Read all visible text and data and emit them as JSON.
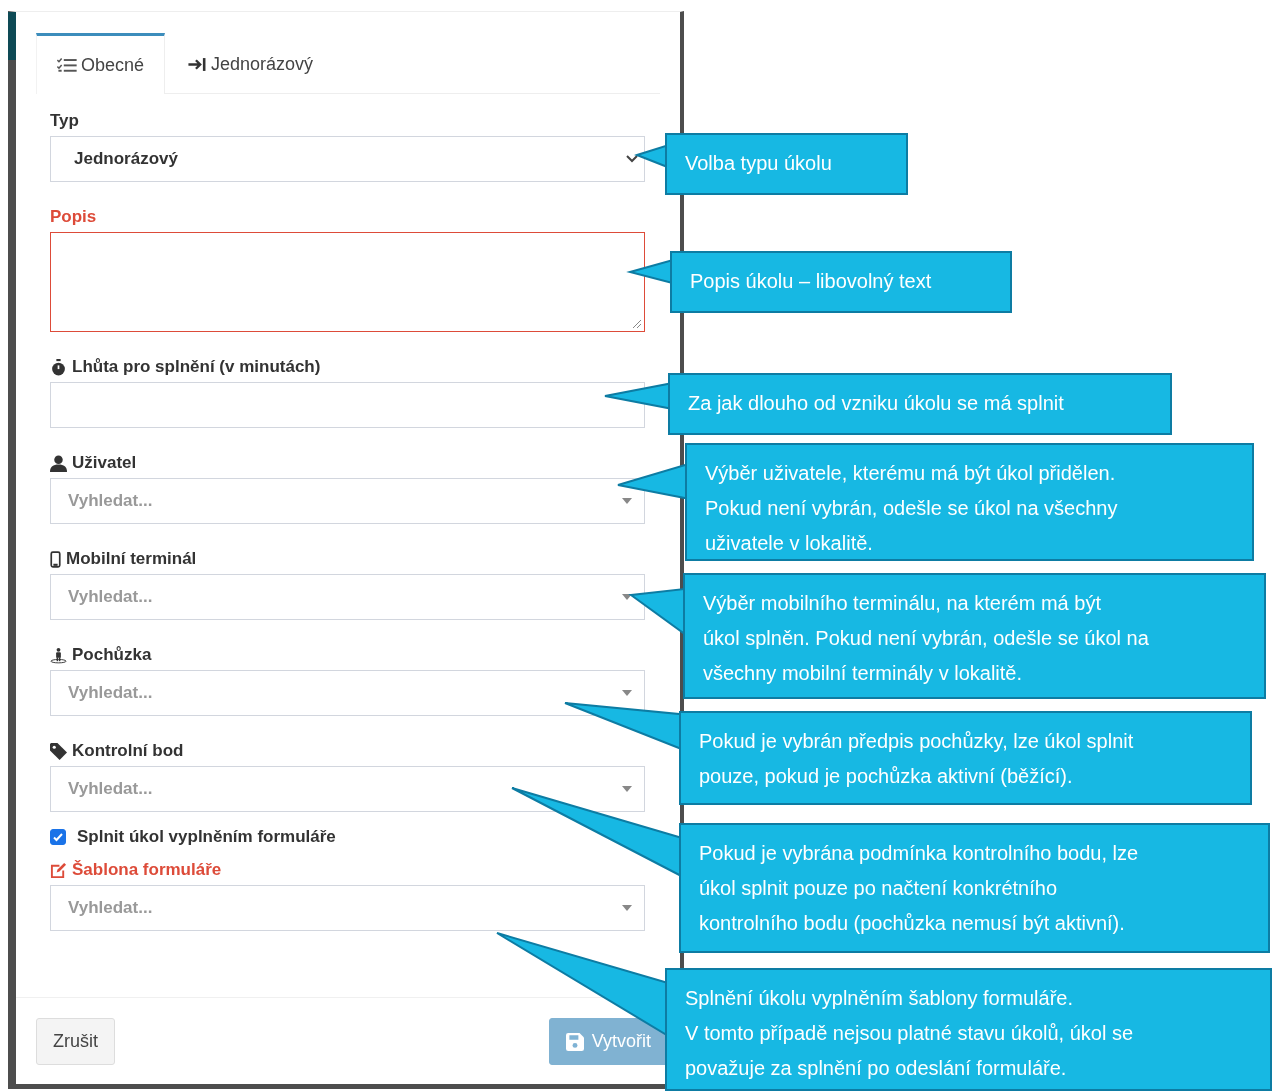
{
  "tabs": [
    {
      "label": "Obecné",
      "selected": true
    },
    {
      "label": "Jednorázový",
      "selected": false
    }
  ],
  "fields": [
    {
      "kind": "select",
      "label": "Typ",
      "value": "Jednorázový",
      "error": false
    },
    {
      "kind": "textarea",
      "label": "Popis",
      "error": true
    },
    {
      "kind": "input",
      "label": "Lhůta pro splnění (v minutách)",
      "error": false
    },
    {
      "kind": "search",
      "label": "Uživatel",
      "placeholder": "Vyhledat...",
      "error": false
    },
    {
      "kind": "search",
      "label": "Mobilní terminál",
      "placeholder": "Vyhledat...",
      "error": false
    },
    {
      "kind": "search",
      "label": "Pochůzka",
      "placeholder": "Vyhledat...",
      "error": false
    },
    {
      "kind": "search",
      "label": "Kontrolní bod",
      "placeholder": "Vyhledat...",
      "error": false
    },
    {
      "kind": "checkbox",
      "label": "Splnit úkol vyplněním formuláře",
      "checked": true
    },
    {
      "kind": "search",
      "label": "Šablona formuláře",
      "placeholder": "Vyhledat...",
      "error": true
    }
  ],
  "buttons": [
    {
      "label": "Zrušit",
      "disabled": false
    },
    {
      "label": "Vytvořit",
      "disabled": true
    }
  ],
  "callouts": [
    {
      "text": "Volba typu úkolu"
    },
    {
      "text": "Popis úkolu – libovolný text"
    },
    {
      "text": "Za jak dlouho od vzniku úkolu se má splnit"
    },
    {
      "text": "Výběr uživatele, kterému má být úkol přidělen.\nPokud není vybrán, odešle se úkol na všechny\nuživatele v lokalitě."
    },
    {
      "text": "Výběr mobilního terminálu, na kterém má být\núkol splněn. Pokud není vybrán, odešle se úkol na\nvšechny mobilní terminály v lokalitě."
    },
    {
      "text": "Pokud je vybrán předpis pochůzky, lze úkol splnit\npouze, pokud je pochůzka aktivní (běžící)."
    },
    {
      "text": "Pokud je vybrána podmínka kontrolního bodu, lze\núkol splnit pouze po načtení konkrétního\nkontrolního bodu (pochůzka nemusí být aktivní)."
    },
    {
      "text": "Splnění úkolu vyplněním šablony formuláře.\nV tomto případě nejsou platné stavu úkolů, úkol se\npovažuje za splnění po odeslání formuláře."
    }
  ]
}
